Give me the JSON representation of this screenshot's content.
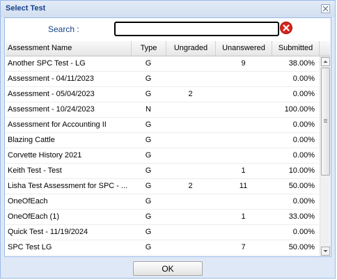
{
  "window": {
    "title": "Select Test"
  },
  "search": {
    "label": "Search :",
    "value": "",
    "placeholder": ""
  },
  "icons": {
    "close": "close-icon",
    "clear": "clear-search-icon"
  },
  "colors": {
    "title_text": "#15428b",
    "clear_button": "#d9231d",
    "panel_border": "#99bbe8"
  },
  "grid": {
    "columns": [
      "Assessment Name",
      "Type",
      "Ungraded",
      "Unanswered",
      "Submitted"
    ],
    "rows": [
      {
        "name": "Another SPC Test - LG",
        "type": "G",
        "ungraded": "",
        "unanswered": "9",
        "submitted": "38.00%"
      },
      {
        "name": "Assessment - 04/11/2023",
        "type": "G",
        "ungraded": "",
        "unanswered": "",
        "submitted": "0.00%"
      },
      {
        "name": "Assessment - 05/04/2023",
        "type": "G",
        "ungraded": "2",
        "unanswered": "",
        "submitted": "0.00%"
      },
      {
        "name": "Assessment - 10/24/2023",
        "type": "N",
        "ungraded": "",
        "unanswered": "",
        "submitted": "100.00%"
      },
      {
        "name": "Assessment for Accounting II",
        "type": "G",
        "ungraded": "",
        "unanswered": "",
        "submitted": "0.00%"
      },
      {
        "name": "Blazing Cattle",
        "type": "G",
        "ungraded": "",
        "unanswered": "",
        "submitted": "0.00%"
      },
      {
        "name": "Corvette History 2021",
        "type": "G",
        "ungraded": "",
        "unanswered": "",
        "submitted": "0.00%"
      },
      {
        "name": "Keith Test - Test",
        "type": "G",
        "ungraded": "",
        "unanswered": "1",
        "submitted": "10.00%"
      },
      {
        "name": "Lisha Test Assessment for SPC - ...",
        "type": "G",
        "ungraded": "2",
        "unanswered": "11",
        "submitted": "50.00%"
      },
      {
        "name": "OneOfEach",
        "type": "G",
        "ungraded": "",
        "unanswered": "",
        "submitted": "0.00%"
      },
      {
        "name": "OneOfEach (1)",
        "type": "G",
        "ungraded": "",
        "unanswered": "1",
        "submitted": "33.00%"
      },
      {
        "name": "Quick Test - 11/19/2024",
        "type": "G",
        "ungraded": "",
        "unanswered": "",
        "submitted": "0.00%"
      },
      {
        "name": "SPC Test LG",
        "type": "G",
        "ungraded": "",
        "unanswered": "7",
        "submitted": "50.00%"
      },
      {
        "name": "",
        "type": "",
        "ungraded": "",
        "unanswered": "",
        "submitted": ""
      }
    ]
  },
  "footer": {
    "ok_label": "OK"
  }
}
